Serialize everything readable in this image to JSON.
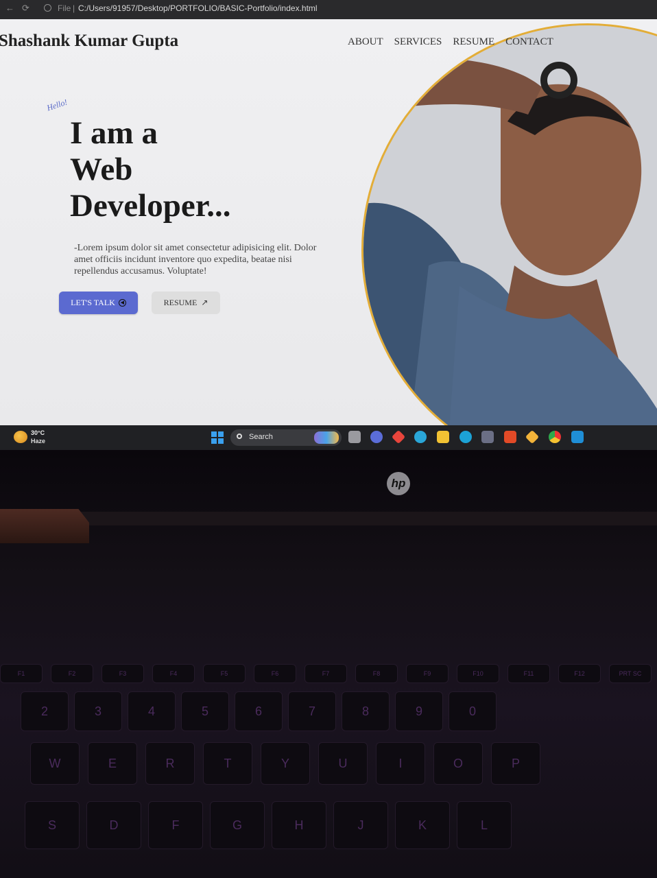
{
  "browser": {
    "file_label": "File",
    "url": "C:/Users/91957/Desktop/PORTFOLIO/BASIC-Portfolio/index.html"
  },
  "site": {
    "brand": "Shashank Kumar Gupta",
    "nav": [
      "ABOUT",
      "SERVICES",
      "RESUME",
      "CONTACT"
    ],
    "hello": "Hello!",
    "headline": [
      "I am a",
      "Web",
      "Developer..."
    ],
    "intro": "-Lorem ipsum dolor sit amet consectetur adipisicing elit. Dolor amet officiis incidunt inventore quo expedita, beatae nisi repellendus accusamus. Voluptate!",
    "buttons": {
      "talk": "LET'S TALK",
      "resume": "RESUME"
    },
    "colors": {
      "accent": "#5b6ad0",
      "ring": "#e3ad37"
    }
  },
  "taskbar": {
    "temperature": "30°C",
    "weather": "Haze",
    "search_label": "Search",
    "apps": [
      "task-view-icon",
      "teams-icon",
      "app-diamond-icon",
      "help-icon",
      "file-explorer-icon",
      "edge-icon",
      "store-icon",
      "brave-icon",
      "git-icon",
      "chrome-icon",
      "vscode-icon"
    ]
  },
  "laptop": {
    "logo": "hp",
    "fkeys": [
      "F1",
      "F2",
      "F3",
      "F4",
      "F5",
      "F6",
      "F7",
      "F8",
      "F9",
      "F10",
      "F11",
      "F12",
      "PRT SC"
    ],
    "num_row": [
      "2",
      "3",
      "4",
      "5",
      "6",
      "7",
      "8",
      "9",
      "0"
    ],
    "qwerty_row": [
      "W",
      "E",
      "R",
      "T",
      "Y",
      "U",
      "I",
      "O",
      "P"
    ],
    "home_row": [
      "S",
      "D",
      "F",
      "G",
      "H",
      "J",
      "K",
      "L"
    ]
  }
}
